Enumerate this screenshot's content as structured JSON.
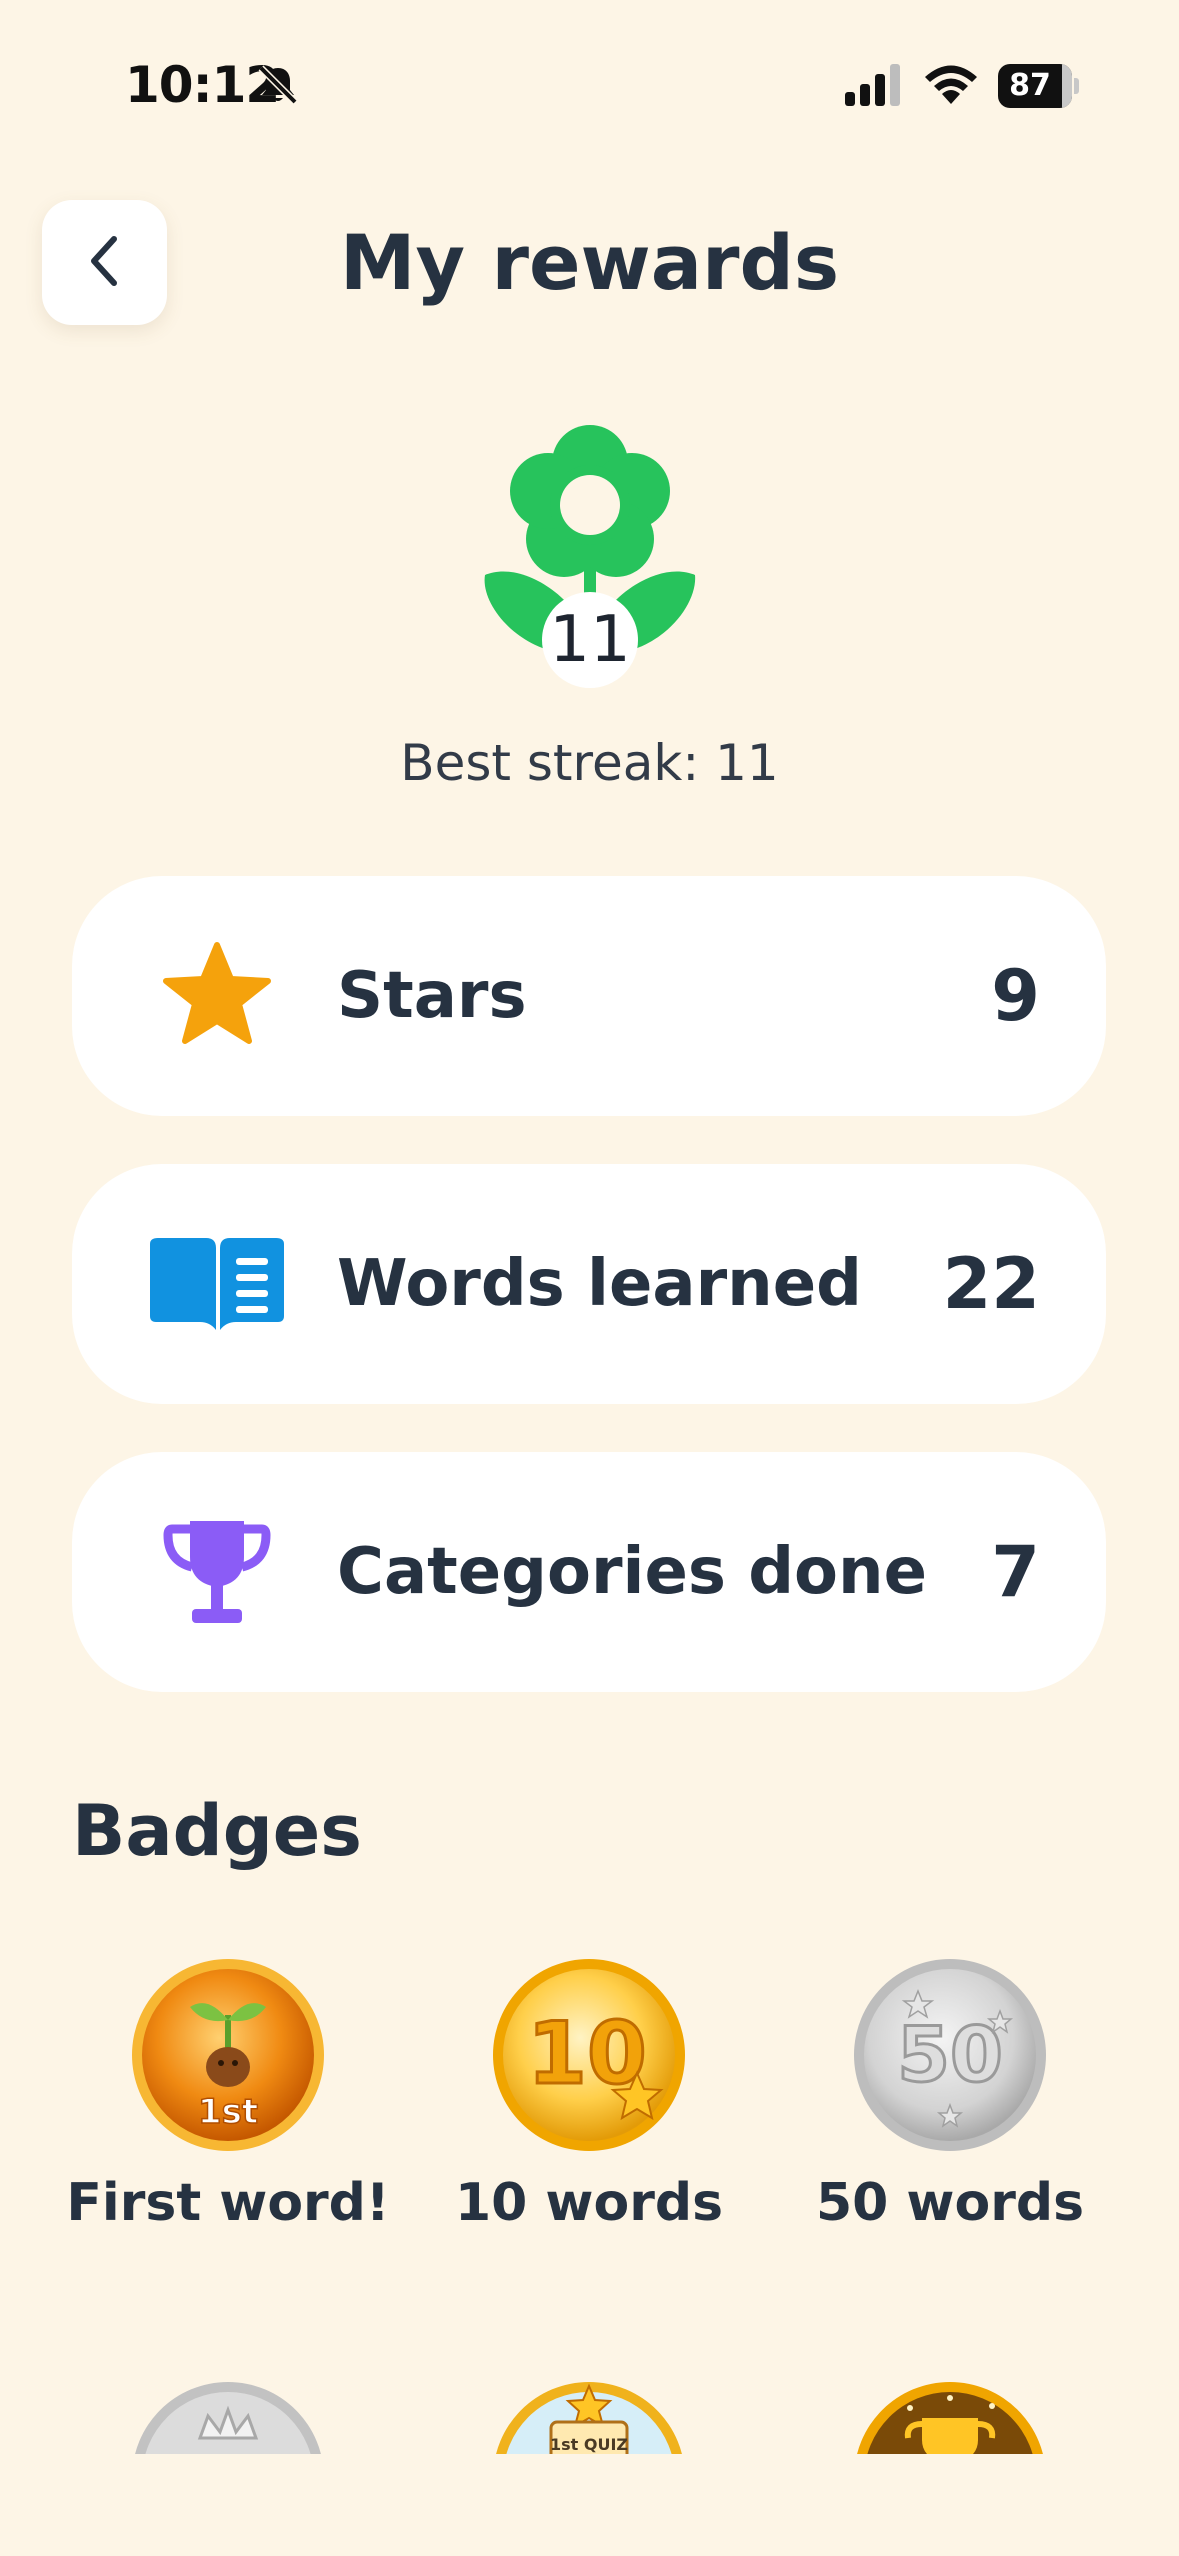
{
  "status_bar": {
    "time": "10:12",
    "battery": "87",
    "battery_level": 0.87,
    "icons": [
      "bell-slash-icon",
      "cellular-signal-icon",
      "wifi-icon",
      "battery-icon"
    ]
  },
  "header": {
    "title": "My rewards",
    "back_icon": "chevron-left-icon"
  },
  "streak": {
    "current": "11",
    "best_label": "Best streak: 11",
    "icon": "flower-icon",
    "color": "#27c35c"
  },
  "stats": [
    {
      "label": "Stars",
      "value": "9",
      "icon": "star-icon",
      "color": "#f5a20c"
    },
    {
      "label": "Words learned",
      "value": "22",
      "icon": "open-book-icon",
      "color": "#1192e0"
    },
    {
      "label": "Categories done",
      "value": "7",
      "icon": "trophy-icon",
      "color": "#8b5cf6"
    }
  ],
  "badges": {
    "heading": "Badges",
    "items": [
      {
        "label": "First word!",
        "medal_text": "1st",
        "icon": "sprout-medal-icon"
      },
      {
        "label": "10 words",
        "medal_text": "10",
        "icon": "gold-10-medal-icon"
      },
      {
        "label": "50 words",
        "medal_text": "50",
        "icon": "silver-50-medal-icon"
      }
    ],
    "partial_row": [
      {
        "icon": "silver-crown-medal-icon"
      },
      {
        "icon": "quiz-medal-icon",
        "medal_text": "1st QUIZ"
      },
      {
        "icon": "gold-trophy-medal-icon"
      }
    ]
  }
}
